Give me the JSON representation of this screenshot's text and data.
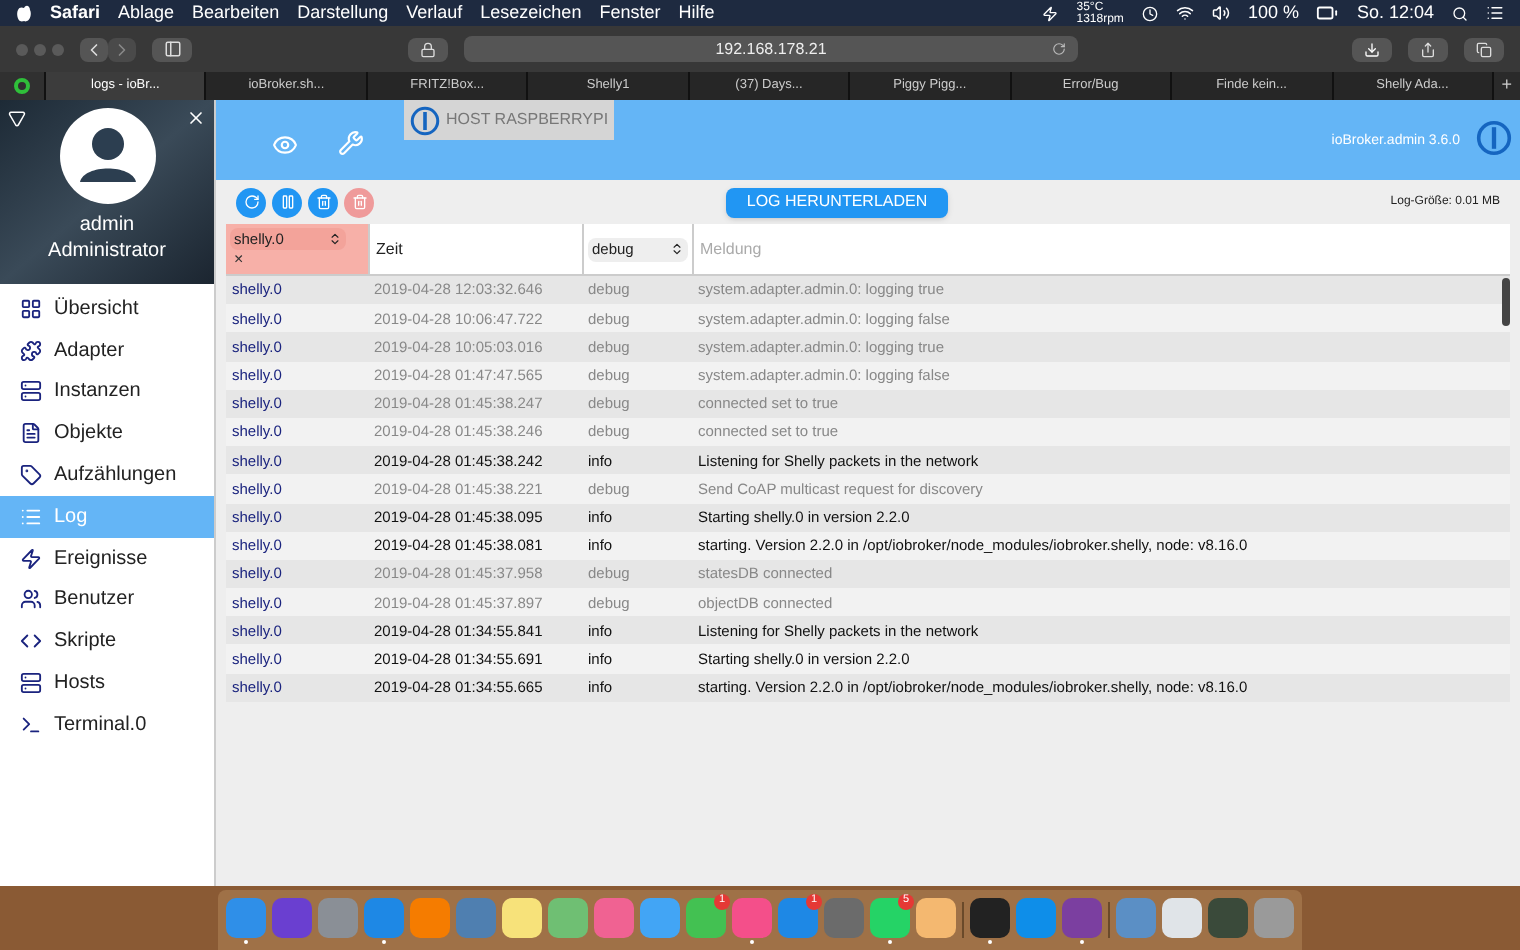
{
  "menubar": {
    "app": "Safari",
    "menus": [
      "Ablage",
      "Bearbeiten",
      "Darstellung",
      "Verlauf",
      "Lesezeichen",
      "Fenster",
      "Hilfe"
    ],
    "temp": "35°C",
    "fan": "1318rpm",
    "battery": "100 %",
    "clock": "So. 12:04"
  },
  "address": "192.168.178.21",
  "tabs": [
    {
      "label": "logs - ioBr...",
      "selected": true
    },
    {
      "label": "ioBroker.sh...",
      "selected": false
    },
    {
      "label": "FRITZ!Box...",
      "selected": false
    },
    {
      "label": "Shelly1",
      "selected": false
    },
    {
      "label": "(37) Days...",
      "selected": false
    },
    {
      "label": "Piggy Pigg...",
      "selected": false
    },
    {
      "label": "Error/Bug",
      "selected": false
    },
    {
      "label": "Finde kein...",
      "selected": false
    },
    {
      "label": "Shelly Ada...",
      "selected": false
    }
  ],
  "new_tab": "+",
  "sidebar": {
    "user": "admin",
    "role": "Administrator",
    "items": [
      {
        "label": "Übersicht",
        "selected": false
      },
      {
        "label": "Adapter",
        "selected": false
      },
      {
        "label": "Instanzen",
        "selected": false
      },
      {
        "label": "Objekte",
        "selected": false
      },
      {
        "label": "Aufzählungen",
        "selected": false
      },
      {
        "label": "Log",
        "selected": true
      },
      {
        "label": "Ereignisse",
        "selected": false
      },
      {
        "label": "Benutzer",
        "selected": false
      },
      {
        "label": "Skripte",
        "selected": false
      },
      {
        "label": "Hosts",
        "selected": false
      },
      {
        "label": "Terminal.0",
        "selected": false
      }
    ]
  },
  "header": {
    "host": "HOST RASPBERRYPI",
    "version": "ioBroker.admin 3.6.0"
  },
  "download_button": "LOG HERUNTERLADEN",
  "log_size": "Log-Größe: 0.01 MB",
  "filters": {
    "adapter": "shelly.0",
    "clear": "×",
    "time": "Zeit",
    "level": "debug",
    "message_placeholder": "Meldung"
  },
  "rows": [
    {
      "source": "shelly.0",
      "time": "2019-04-28 12:03:32.646",
      "kind": "debug",
      "level_text": "debug",
      "message": "system.adapter.admin.0: logging true"
    },
    {
      "source": "shelly.0",
      "time": "2019-04-28 10:06:47.722",
      "kind": "debug",
      "level_text": "debug",
      "message": "system.adapter.admin.0: logging false"
    },
    {
      "source": "shelly.0",
      "time": "2019-04-28 10:05:03.016",
      "kind": "debug",
      "level_text": "debug",
      "message": "system.adapter.admin.0: logging true"
    },
    {
      "source": "shelly.0",
      "time": "2019-04-28 01:47:47.565",
      "kind": "debug",
      "level_text": "debug",
      "message": "system.adapter.admin.0: logging false"
    },
    {
      "source": "shelly.0",
      "time": "2019-04-28 01:45:38.247",
      "kind": "debug",
      "level_text": "debug",
      "message": "connected set to true"
    },
    {
      "source": "shelly.0",
      "time": "2019-04-28 01:45:38.246",
      "kind": "debug",
      "level_text": "debug",
      "message": "connected set to true"
    },
    {
      "source": "shelly.0",
      "time": "2019-04-28 01:45:38.242",
      "kind": "info",
      "level_text": "info",
      "message": "Listening for Shelly packets in the network"
    },
    {
      "source": "shelly.0",
      "time": "2019-04-28 01:45:38.221",
      "kind": "debug",
      "level_text": "debug",
      "message": "Send CoAP multicast request for discovery"
    },
    {
      "source": "shelly.0",
      "time": "2019-04-28 01:45:38.095",
      "kind": "info",
      "level_text": "info",
      "message": "Starting shelly.0 in version 2.2.0"
    },
    {
      "source": "shelly.0",
      "time": "2019-04-28 01:45:38.081",
      "kind": "info",
      "level_text": "info",
      "message": "starting. Version 2.2.0 in /opt/iobroker/node_modules/iobroker.shelly, node: v8.16.0"
    },
    {
      "source": "shelly.0",
      "time": "2019-04-28 01:45:37.958",
      "kind": "debug",
      "level_text": "debug",
      "message": "statesDB connected"
    },
    {
      "source": "shelly.0",
      "time": "2019-04-28 01:45:37.897",
      "kind": "debug",
      "level_text": "debug",
      "message": "objectDB connected"
    },
    {
      "source": "shelly.0",
      "time": "2019-04-28 01:34:55.841",
      "kind": "info",
      "level_text": "info",
      "message": "Listening for Shelly packets in the network"
    },
    {
      "source": "shelly.0",
      "time": "2019-04-28 01:34:55.691",
      "kind": "info",
      "level_text": "info",
      "message": "Starting shelly.0 in version 2.2.0"
    },
    {
      "source": "shelly.0",
      "time": "2019-04-28 01:34:55.665",
      "kind": "info",
      "level_text": "info",
      "message": "starting. Version 2.2.0 in /opt/iobroker/node_modules/iobroker.shelly, node: v8.16.0"
    }
  ],
  "dock": [
    {
      "color": "#2f8fe8",
      "running": true
    },
    {
      "color": "#6a3fd0",
      "running": false
    },
    {
      "color": "#8a8f96",
      "running": false
    },
    {
      "color": "#1e88e5",
      "running": true
    },
    {
      "color": "#f57c00",
      "running": false
    },
    {
      "color": "#4f7fb0",
      "running": false
    },
    {
      "color": "#f7e27a",
      "running": false
    },
    {
      "color": "#6fbf73",
      "running": false
    },
    {
      "color": "#f06292",
      "running": false
    },
    {
      "color": "#42a5f5",
      "running": false
    },
    {
      "color": "#43c152",
      "running": false,
      "badge": "1"
    },
    {
      "color": "#f44f8a",
      "running": true
    },
    {
      "color": "#1e88e5",
      "running": false,
      "badge": "1"
    },
    {
      "color": "#6b6b6b",
      "running": false
    },
    {
      "color": "#25d366",
      "running": true,
      "badge": "5"
    },
    {
      "color": "#f4b870",
      "running": false
    },
    {
      "color": "#222222",
      "running": true,
      "divider": true
    },
    {
      "color": "#0e8ee9",
      "running": false
    },
    {
      "color": "#7b3fa0",
      "running": true
    },
    {
      "color": "#5b8fc5",
      "running": false,
      "divider": true
    },
    {
      "color": "#e0e4e8",
      "running": false
    },
    {
      "color": "#3a4a3a",
      "running": false
    },
    {
      "color": "#9a9a9a",
      "running": false
    }
  ]
}
